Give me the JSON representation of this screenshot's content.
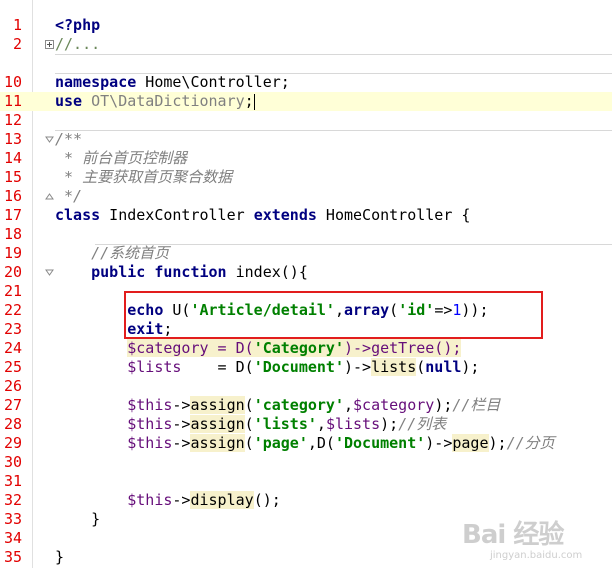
{
  "editor": {
    "lines": [
      {
        "num": "1",
        "text": "<?php"
      },
      {
        "num": "2",
        "text": "//..."
      },
      {
        "num": "10",
        "text": "namespace Home\\Controller;"
      },
      {
        "num": "11",
        "text": "use OT\\DataDictionary;"
      },
      {
        "num": "12",
        "text": ""
      },
      {
        "num": "13",
        "text": "/**"
      },
      {
        "num": "14",
        "text": " * 前台首页控制器"
      },
      {
        "num": "15",
        "text": " * 主要获取首页聚合数据"
      },
      {
        "num": "16",
        "text": " */"
      },
      {
        "num": "17",
        "text": "class IndexController extends HomeController {"
      },
      {
        "num": "18",
        "text": ""
      },
      {
        "num": "19",
        "text": "    //系统首页"
      },
      {
        "num": "20",
        "text": "    public function index(){"
      },
      {
        "num": "21",
        "text": ""
      },
      {
        "num": "22",
        "text": "        echo U('Article/detail',array('id'=>1));"
      },
      {
        "num": "23",
        "text": "        exit;"
      },
      {
        "num": "24",
        "text": "        $category = D('Category')->getTree();"
      },
      {
        "num": "25",
        "text": "        $lists    = D('Document')->lists(null);"
      },
      {
        "num": "26",
        "text": ""
      },
      {
        "num": "27",
        "text": "        $this->assign('category',$category);//栏目"
      },
      {
        "num": "28",
        "text": "        $this->assign('lists',$lists);//列表"
      },
      {
        "num": "29",
        "text": "        $this->assign('page',D('Document')->page);//分页"
      },
      {
        "num": "30",
        "text": ""
      },
      {
        "num": "31",
        "text": ""
      },
      {
        "num": "32",
        "text": "        $this->display();"
      },
      {
        "num": "33",
        "text": "    }"
      },
      {
        "num": "34",
        "text": ""
      },
      {
        "num": "35",
        "text": "}"
      }
    ]
  },
  "watermark": {
    "logo": "Bai 经验",
    "sub": "jingyan.baidu.com"
  },
  "colors": {
    "keyword": "#000080",
    "string": "#008000",
    "line_number": "#e20000",
    "highlight_box": "#e21d1d",
    "current_line": "#ffffd7"
  }
}
